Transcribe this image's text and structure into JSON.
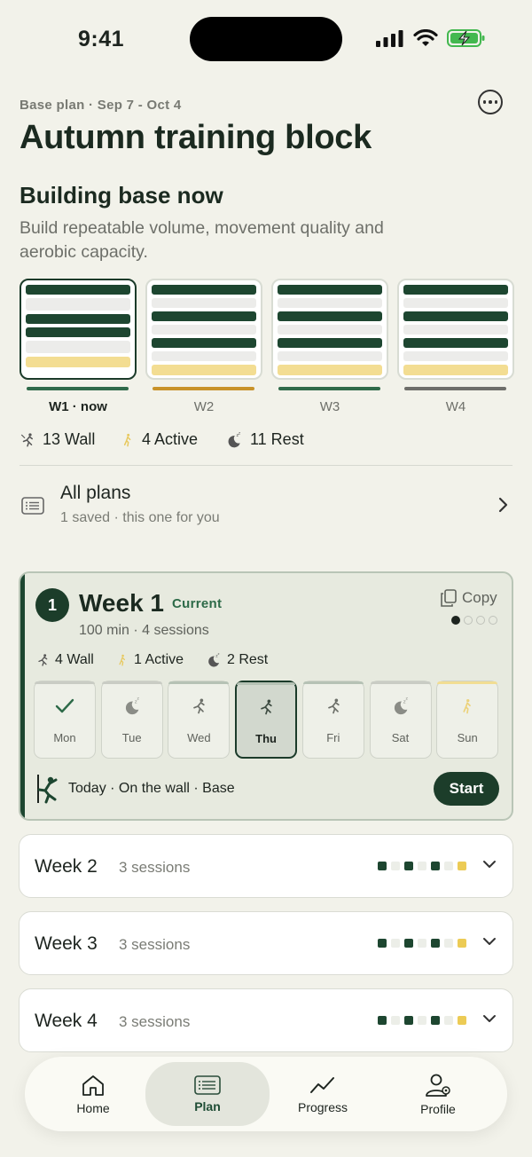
{
  "status_bar": {
    "time": "9:41"
  },
  "header": {
    "subtitle": "Base plan · Sep 7 - Oct 4",
    "title": "Autumn training block",
    "phase_title": "Building base now",
    "phase_description": "Build repeatable volume, movement quality and aerobic capacity."
  },
  "overview_weeks": [
    {
      "label": "W1 · now",
      "rows": [
        "dark",
        "light",
        "dark",
        "dark",
        "light",
        "yellow"
      ],
      "underline_color": "#2f6a4a",
      "selected": true
    },
    {
      "label": "W2",
      "rows": [
        "dark",
        "light",
        "dark",
        "light",
        "dark",
        "light",
        "yellow"
      ],
      "underline_color": "#c8922a",
      "selected": false
    },
    {
      "label": "W3",
      "rows": [
        "dark",
        "light",
        "dark",
        "light",
        "dark",
        "light",
        "yellow"
      ],
      "underline_color": "#2f6a4a",
      "selected": false
    },
    {
      "label": "W4",
      "rows": [
        "dark",
        "light",
        "dark",
        "light",
        "dark",
        "light",
        "yellow"
      ],
      "underline_color": "#6e6e6a",
      "selected": false
    }
  ],
  "plan_summary": {
    "wall": "13 Wall",
    "active": "4 Active",
    "rest": "11 Rest"
  },
  "all_plans": {
    "title": "All plans",
    "subtitle": "1 saved · this one for you"
  },
  "current_week": {
    "number": "1",
    "title": "Week 1",
    "tag": "Current",
    "meta": "100 min · 4 sessions",
    "copy_label": "Copy",
    "summary": {
      "wall": "4 Wall",
      "active": "1 Active",
      "rest": "2 Rest"
    },
    "days": [
      {
        "label": "Mon",
        "icon": "check-icon",
        "state": "done"
      },
      {
        "label": "Tue",
        "icon": "rest-moon-icon",
        "state": "rest"
      },
      {
        "label": "Wed",
        "icon": "climber-icon",
        "state": "wall"
      },
      {
        "label": "Thu",
        "icon": "climber-icon",
        "state": "selected"
      },
      {
        "label": "Fri",
        "icon": "climber-icon",
        "state": "wall"
      },
      {
        "label": "Sat",
        "icon": "rest-moon-icon",
        "state": "rest"
      },
      {
        "label": "Sun",
        "icon": "active-walker-icon",
        "state": "active"
      }
    ],
    "today_text": "Today · On the wall · Base",
    "start_label": "Start"
  },
  "other_weeks": [
    {
      "title": "Week 2",
      "sessions": "3 sessions",
      "dots": [
        "d",
        "e",
        "d",
        "e",
        "d",
        "e",
        "y"
      ]
    },
    {
      "title": "Week 3",
      "sessions": "3 sessions",
      "dots": [
        "d",
        "e",
        "d",
        "e",
        "d",
        "e",
        "y"
      ]
    },
    {
      "title": "Week 4",
      "sessions": "3 sessions",
      "dots": [
        "d",
        "e",
        "d",
        "e",
        "d",
        "e",
        "y"
      ]
    }
  ],
  "tabs": [
    {
      "label": "Home",
      "icon": "home-icon",
      "active": false
    },
    {
      "label": "Plan",
      "icon": "plan-icon",
      "active": true
    },
    {
      "label": "Progress",
      "icon": "progress-icon",
      "active": false
    },
    {
      "label": "Profile",
      "icon": "profile-icon",
      "active": false
    }
  ],
  "colors": {
    "accent_dark": "#1c3d2a",
    "accent_green": "#2d6a48",
    "accent_yellow": "#eccb55",
    "background": "#f2f2ea"
  }
}
